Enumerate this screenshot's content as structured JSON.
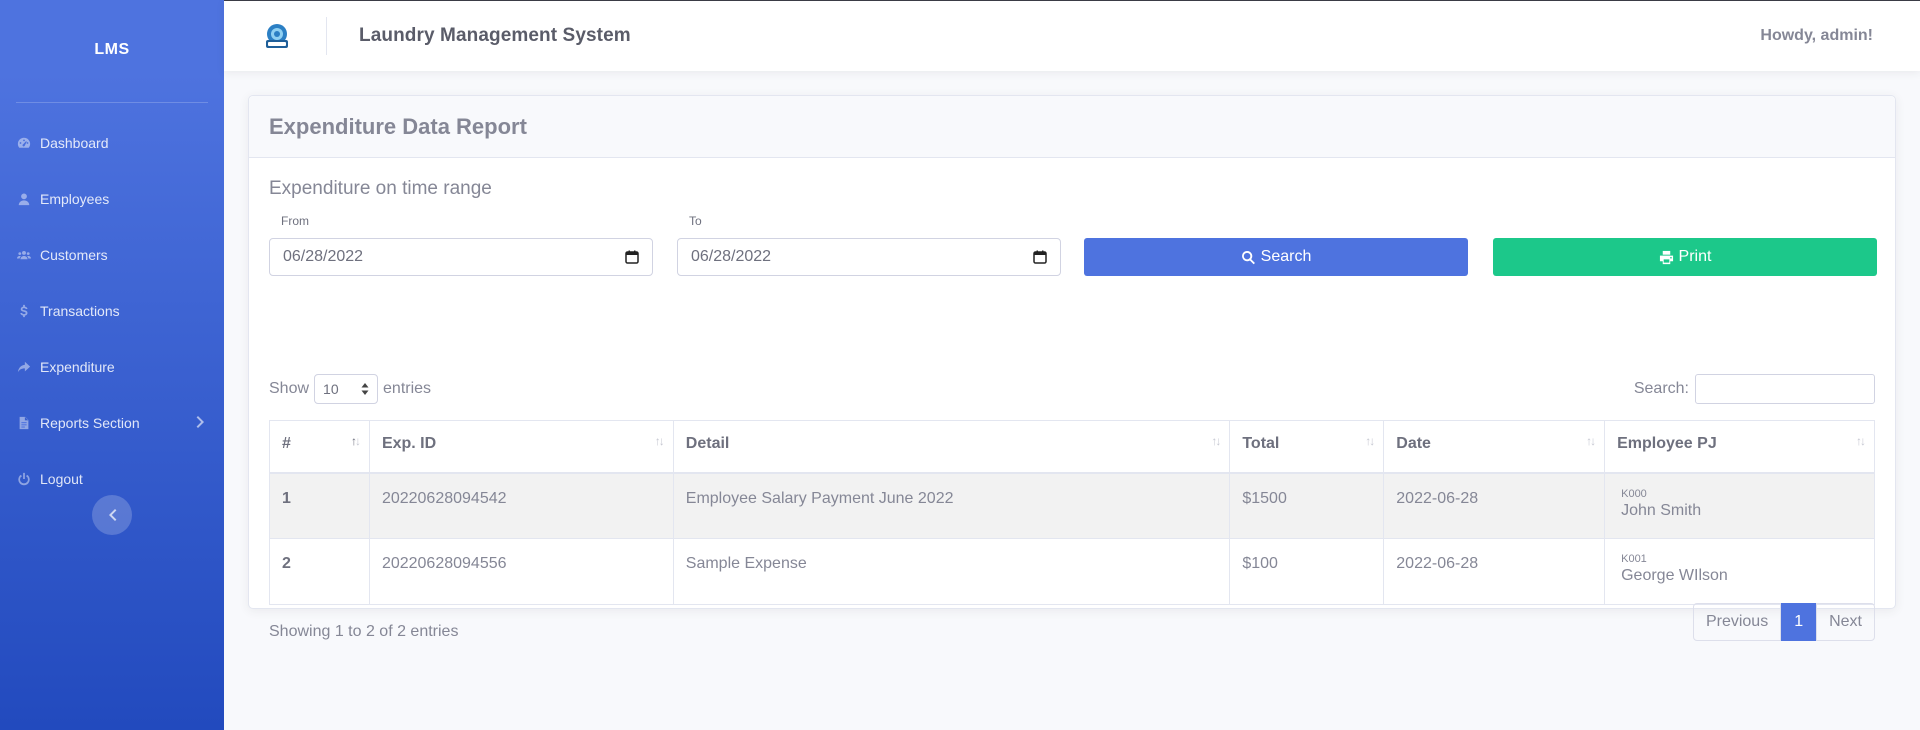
{
  "sidebar": {
    "brand": "LMS",
    "items": [
      {
        "label": "Dashboard",
        "icon": "tachometer-icon"
      },
      {
        "label": "Employees",
        "icon": "user-icon"
      },
      {
        "label": "Customers",
        "icon": "users-icon"
      },
      {
        "label": "Transactions",
        "icon": "dollar-icon"
      },
      {
        "label": "Expenditure",
        "icon": "share-icon"
      },
      {
        "label": "Reports Section",
        "icon": "file-icon"
      },
      {
        "label": "Logout",
        "icon": "power-icon"
      }
    ]
  },
  "topbar": {
    "title": "Laundry Management System",
    "greeting": "Howdy, admin!"
  },
  "card": {
    "title": "Expenditure Data Report",
    "section_title": "Expenditure on time range",
    "from_label": "From",
    "to_label": "To",
    "from_value": "06/28/2022",
    "to_value": "06/28/2022",
    "search_button": "Search",
    "print_button": "Print"
  },
  "table_controls": {
    "show": "Show",
    "entries": "entries",
    "page_size": "10",
    "search_label": "Search:"
  },
  "table": {
    "headers": [
      "#",
      "Exp. ID",
      "Detail",
      "Total",
      "Date",
      "Employee PJ"
    ],
    "rows": [
      {
        "num": "1",
        "exp_id": "20220628094542",
        "detail": "Employee Salary Payment June 2022",
        "total": "$1500",
        "date": "2022-06-28",
        "emp_code": "K000",
        "emp_name": "John Smith"
      },
      {
        "num": "2",
        "exp_id": "20220628094556",
        "detail": "Sample Expense",
        "total": "$100",
        "date": "2022-06-28",
        "emp_code": "K001",
        "emp_name": "George WIlson"
      }
    ]
  },
  "footer": {
    "info": "Showing 1 to 2 of 2 entries",
    "previous": "Previous",
    "page": "1",
    "next": "Next"
  },
  "colors": {
    "primary": "#4e73df",
    "success": "#1cc88a",
    "text": "#858796"
  }
}
